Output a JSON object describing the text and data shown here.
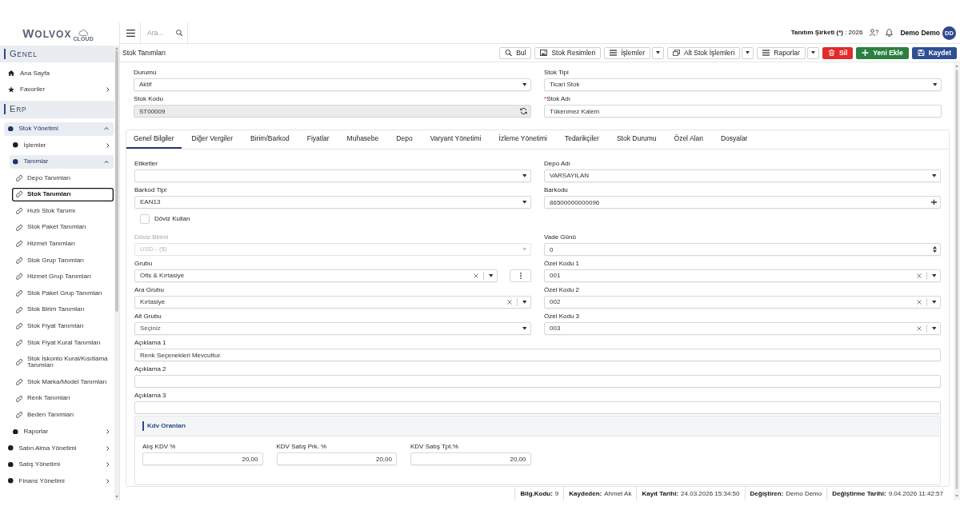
{
  "sidebar": {
    "logo": "WOLVOX",
    "logo_suffix": "CLOUD",
    "sections": [
      {
        "title": "GENEL",
        "items": [
          {
            "label": "Ana Sayfa"
          },
          {
            "label": "Favoriler",
            "expanded": false
          }
        ]
      },
      {
        "title": "ERP",
        "items": [
          {
            "label": "Stok Yönetimi",
            "expanded": true,
            "children": [
              {
                "label": "İşlemler",
                "expanded": false
              },
              {
                "label": "Tanımlar",
                "expanded": true,
                "children": [
                  {
                    "label": "Depo Tanımları",
                    "selected": false
                  },
                  {
                    "label": "Stok Tanımları",
                    "selected": true
                  },
                  {
                    "label": "Hızlı Stok Tanımı",
                    "selected": false
                  },
                  {
                    "label": "Stok Paket Tanımları",
                    "selected": false
                  },
                  {
                    "label": "Hizmet Tanımları",
                    "selected": false
                  },
                  {
                    "label": "Stok Grup Tanımları",
                    "selected": false
                  },
                  {
                    "label": "Hizmet Grup Tanımları",
                    "selected": false
                  },
                  {
                    "label": "Stok Paket Grup Tanımları",
                    "selected": false
                  },
                  {
                    "label": "Stok Birim Tanımları",
                    "selected": false
                  },
                  {
                    "label": "Stok Fiyat Tanımları",
                    "selected": false
                  },
                  {
                    "label": "Stok Fiyat Kural Tanımları",
                    "selected": false
                  },
                  {
                    "label": "Stok İskonto Kural/Kısıtlama Tanımları",
                    "selected": false
                  },
                  {
                    "label": "Stok Marka/Model Tanımları",
                    "selected": false
                  },
                  {
                    "label": "Renk Tanımları",
                    "selected": false
                  },
                  {
                    "label": "Beden Tanımları",
                    "selected": false
                  }
                ]
              },
              {
                "label": "Raporlar",
                "expanded": false
              }
            ]
          },
          {
            "label": "Satın Alma Yönetimi",
            "expanded": false
          },
          {
            "label": "Satış Yönetimi",
            "expanded": false
          },
          {
            "label": "Finans Yönetimi",
            "expanded": false
          }
        ]
      }
    ]
  },
  "topbar": {
    "search": {
      "placeholder": "Ara..."
    },
    "company": "Tanıtım Şirketi (*)",
    "period": ": 2026",
    "user": "Demo Demo",
    "avatar": "DD"
  },
  "page": {
    "title": "Stok Tanımları",
    "actions": [
      {
        "label": "Bul",
        "kind": "plain"
      },
      {
        "label": "Stok Resimleri",
        "kind": "plain"
      },
      {
        "label": "İşlemler",
        "kind": "split"
      },
      {
        "label": "Alt Stok İşlemleri",
        "kind": "split"
      },
      {
        "label": "Raporlar",
        "kind": "split"
      },
      {
        "label": "Sil",
        "kind": "danger"
      },
      {
        "label": "Yeni Ekle",
        "kind": "success"
      },
      {
        "label": "Kaydet",
        "kind": "primary"
      }
    ]
  },
  "header_fields": [
    {
      "label": "Durumu",
      "kind": "select",
      "value": "Aktif",
      "clearable": false,
      "disabled": false
    },
    {
      "label": "Stok Tipi",
      "kind": "select",
      "value": "Ticari Stok",
      "clearable": false,
      "disabled": false
    },
    {
      "label": "Stok Kodu",
      "kind": "code",
      "value": "ST00009",
      "disabled": false
    },
    {
      "label": "Stok Adı",
      "kind": "text",
      "required_mark": "*",
      "value": "Tükenmez Kalem",
      "disabled": false
    }
  ],
  "tabs": [
    {
      "label": "Genel Bilgiler",
      "selected": true
    },
    {
      "label": "Diğer Vergiler",
      "selected": false
    },
    {
      "label": "Birim/Barkod",
      "selected": false
    },
    {
      "label": "Fiyatlar",
      "selected": false
    },
    {
      "label": "Muhasebe",
      "selected": false
    },
    {
      "label": "Depo",
      "selected": false
    },
    {
      "label": "Varyant Yönetimi",
      "selected": false
    },
    {
      "label": "İzleme Yönetimi",
      "selected": false
    },
    {
      "label": "Tedarikçiler",
      "selected": false
    },
    {
      "label": "Stok Durumu",
      "selected": false
    },
    {
      "label": "Özel Alan",
      "selected": false
    },
    {
      "label": "Dosyalar",
      "selected": false
    }
  ],
  "general_tab": {
    "rows": [
      [
        {
          "label": "Etiketler",
          "kind": "select",
          "clearable": false,
          "disabled": false
        },
        {
          "label": "Depo Adı",
          "kind": "select",
          "value": "VARSAYILAN",
          "clearable": false,
          "disabled": false
        }
      ],
      [
        {
          "label": "Barkod Tipi",
          "kind": "select",
          "value": "EAN13",
          "clearable": false,
          "disabled": false
        },
        {
          "label": "Barkodu",
          "kind": "text_add",
          "value": "86500000000096",
          "disabled": false
        }
      ],
      [
        {
          "label": "Döviz Kullan",
          "kind": "checkbox",
          "checked": false,
          "disabled": false
        }
      ],
      [
        {
          "label": "Döviz Birimi",
          "kind": "select",
          "value": "USD - ($)",
          "clearable": false,
          "disabled": true
        },
        {
          "label": "Vade Günü",
          "kind": "number",
          "value": "0",
          "disabled": false
        }
      ],
      [
        {
          "label": "Grubu",
          "kind": "select_menu",
          "value": "Ofis & Kırtasiye",
          "clearable": true,
          "disabled": false
        },
        {
          "label": "Özel Kodu 1",
          "kind": "select",
          "value": "001",
          "clearable": true,
          "disabled": false
        }
      ],
      [
        {
          "label": "Ara Grubu",
          "kind": "select",
          "value": "Kırtasiye",
          "clearable": true,
          "disabled": false
        },
        {
          "label": "Özel Kodu 2",
          "kind": "select",
          "value": "002",
          "clearable": true,
          "disabled": false
        }
      ],
      [
        {
          "label": "Alt Grubu",
          "kind": "select",
          "placeholder": "Seçiniz",
          "clearable": false,
          "disabled": false
        },
        {
          "label": "Özel Kodu 3",
          "kind": "select",
          "value": "003",
          "clearable": true,
          "disabled": false
        }
      ],
      [
        {
          "label": "Açıklama 1",
          "kind": "text",
          "value": "Renk Seçenekleri Mevcuttur.",
          "disabled": false
        }
      ],
      [
        {
          "label": "Açıklama 2",
          "kind": "text",
          "disabled": false
        }
      ],
      [
        {
          "label": "Açıklama 3",
          "kind": "text",
          "disabled": false
        }
      ]
    ],
    "vat_section": {
      "title": "Kdv Oranları",
      "fields": [
        {
          "label": "Alış KDV %",
          "value": "20,00"
        },
        {
          "label": "KDV Satış Prk. %",
          "value": "20,00"
        },
        {
          "label": "KDV Satış Tpt.%",
          "value": "20,00"
        }
      ]
    }
  },
  "status_bar": [
    {
      "label": "Bilg.Kodu:",
      "value": "9"
    },
    {
      "label": "Kaydeden:",
      "value": "Ahmet Ak"
    },
    {
      "label": "Kayıt Tarihi:",
      "value": "24.03.2026 15:34:50"
    },
    {
      "label": "Değiştiren:",
      "value": "Demo Demo"
    },
    {
      "label": "Değiştirme Tarihi:",
      "value": "9.04.2026 11:42:57"
    }
  ]
}
